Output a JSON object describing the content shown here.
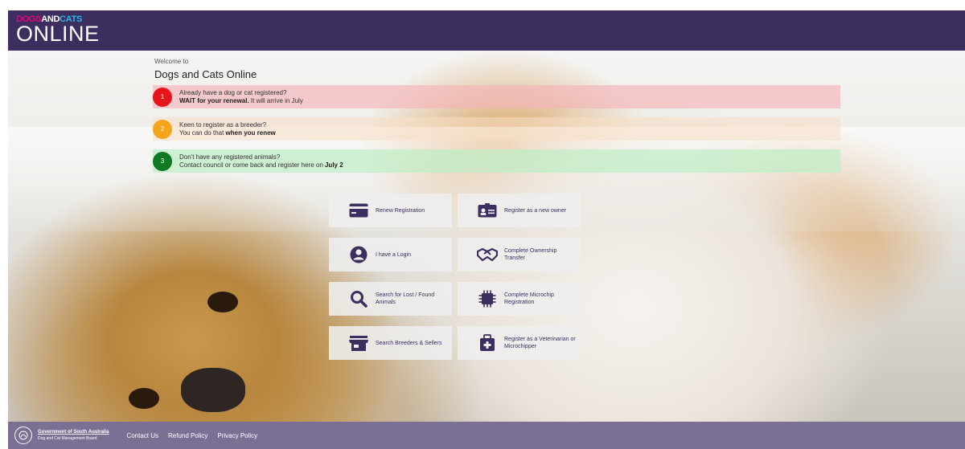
{
  "header": {
    "logo_line1_a": "DOGS",
    "logo_line1_b": "AND",
    "logo_line1_c": "CATS",
    "logo_line2": "ONLINE"
  },
  "welcome": {
    "small": "Welcome to",
    "title": "Dogs and Cats Online"
  },
  "notices": [
    {
      "number": "1",
      "line1": "Already have a dog or cat registered?",
      "line2_bold": "WAIT for your renewal.",
      "line2_rest": " It will arrive in July",
      "color": "#e8141b"
    },
    {
      "number": "2",
      "line1": "Keen to register as a breeder?",
      "line2_rest": "You can do that ",
      "line2_bold": "when you renew",
      "color": "#f5a51a"
    },
    {
      "number": "3",
      "line1": "Don't have any registered animals?",
      "line2_rest": "Contact council or come back and register here on ",
      "line2_bold": "July 2",
      "color": "#0e7b24"
    }
  ],
  "tiles": [
    {
      "label": "Renew Registration",
      "icon": "credit-card-icon"
    },
    {
      "label": "Register as a new owner",
      "icon": "id-card-icon"
    },
    {
      "label": "I have a Login",
      "icon": "user-icon"
    },
    {
      "label": "Complete Ownership Transfer",
      "icon": "handshake-icon"
    },
    {
      "label": "Search for Lost / Found Animals",
      "icon": "search-icon"
    },
    {
      "label": "Complete Microchip Registration",
      "icon": "microchip-icon"
    },
    {
      "label": "Search Breeders & Sellers",
      "icon": "store-icon"
    },
    {
      "label": "Register as a Veterinarian or Microchipper",
      "icon": "medical-kit-icon"
    }
  ],
  "footer": {
    "gov_line1": "Government of South Australia",
    "gov_line2": "Dog and Cat Management Board",
    "links": [
      "Contact Us",
      "Refund Policy",
      "Privacy Policy"
    ]
  },
  "colors": {
    "brand_purple": "#3c2f5f",
    "footer_purple": "#7c6f94",
    "tile_text": "#3c2f5f"
  }
}
